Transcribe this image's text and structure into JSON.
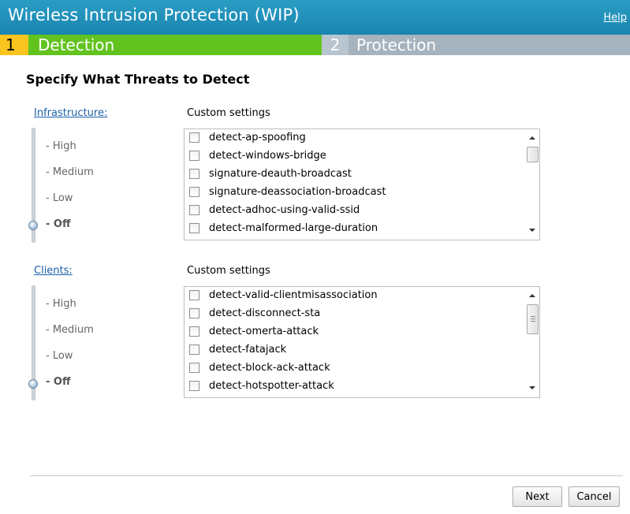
{
  "window": {
    "title": "Wireless Intrusion Protection (WIP)",
    "help_label": "Help"
  },
  "steps": [
    {
      "number": "1",
      "label": "Detection",
      "active": true
    },
    {
      "number": "2",
      "label": "Protection",
      "active": false
    }
  ],
  "heading": "Specify What Threats to Detect",
  "infrastructure": {
    "link_label": "Infrastructure:",
    "custom_label": "Custom settings",
    "levels": [
      "- High",
      "- Medium",
      "- Low",
      "- Off"
    ],
    "selected_level": "- Off",
    "items": [
      "detect-ap-spoofing",
      "detect-windows-bridge",
      "signature-deauth-broadcast",
      "signature-deassociation-broadcast",
      "detect-adhoc-using-valid-ssid",
      "detect-malformed-large-duration"
    ]
  },
  "clients": {
    "link_label": "Clients:",
    "custom_label": "Custom settings",
    "levels": [
      "- High",
      "- Medium",
      "- Low",
      "- Off"
    ],
    "selected_level": "- Off",
    "items": [
      "detect-valid-clientmisassociation",
      "detect-disconnect-sta",
      "detect-omerta-attack",
      "detect-fatajack",
      "detect-block-ack-attack",
      "detect-hotspotter-attack"
    ]
  },
  "footer": {
    "next_label": "Next",
    "cancel_label": "Cancel"
  },
  "colors": {
    "titlebar": "#1a86b0",
    "step_active": "#62c31f",
    "step_number_active": "#f8c41d",
    "step_inactive": "#a5b3be",
    "link": "#1a5fa8"
  }
}
